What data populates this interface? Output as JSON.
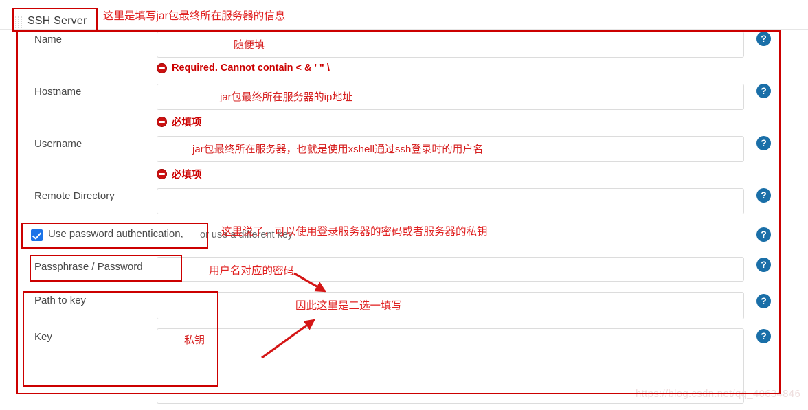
{
  "window": {
    "tab_label": "SSH Server",
    "grip_icon": "drag-handle-icon"
  },
  "form": {
    "rows": [
      {
        "label": "Name",
        "value": "随便填",
        "help_icon": "help-circle-icon",
        "error": "Required. Cannot contain < & ' \" \\"
      },
      {
        "label": "Hostname",
        "value": "jar包最终所在服务器的ip地址",
        "help_icon": "help-circle-icon",
        "error": "必填项"
      },
      {
        "label": "Username",
        "value": "jar包最终所在服务器，也就是使用xshell通过ssh登录时的用户名",
        "help_icon": "help-circle-icon",
        "error": "必填项"
      },
      {
        "label": "Remote Directory",
        "value": "",
        "help_icon": "help-circle-icon",
        "error": ""
      }
    ],
    "checkbox": {
      "checked": true,
      "label": "Use password authentication,",
      "sub_label": "or use a different key",
      "icon": "checkbox-checked-icon",
      "help_icon": "help-circle-icon"
    },
    "passphrase": {
      "label": "Passphrase / Password",
      "value": "",
      "help_icon": "help-circle-icon"
    },
    "path_to_key": {
      "label": "Path to key",
      "value": "",
      "help_icon": "help-circle-icon"
    },
    "key": {
      "label": "Key",
      "value": "私钥",
      "help_icon": "help-circle-icon"
    }
  },
  "annotations": {
    "title_note": "这里是填写jar包最终所在服务器的信息",
    "auth_note": "这里说了，可以使用登录服务器的密码或者服务器的私钥",
    "password_note": "用户名对应的密码",
    "either_or_note": "因此这里是二选一填写"
  },
  "watermark": "https://blog.csdn.net/qq_40634846",
  "colors": {
    "annotation_red": "#e02020",
    "box_red": "#cc0000",
    "help_blue": "#1a6fa8",
    "checkbox_blue": "#1a73e8",
    "error_red": "#cc0000",
    "label_gray": "#4a4a4a",
    "field_border": "#dcdcdc"
  }
}
